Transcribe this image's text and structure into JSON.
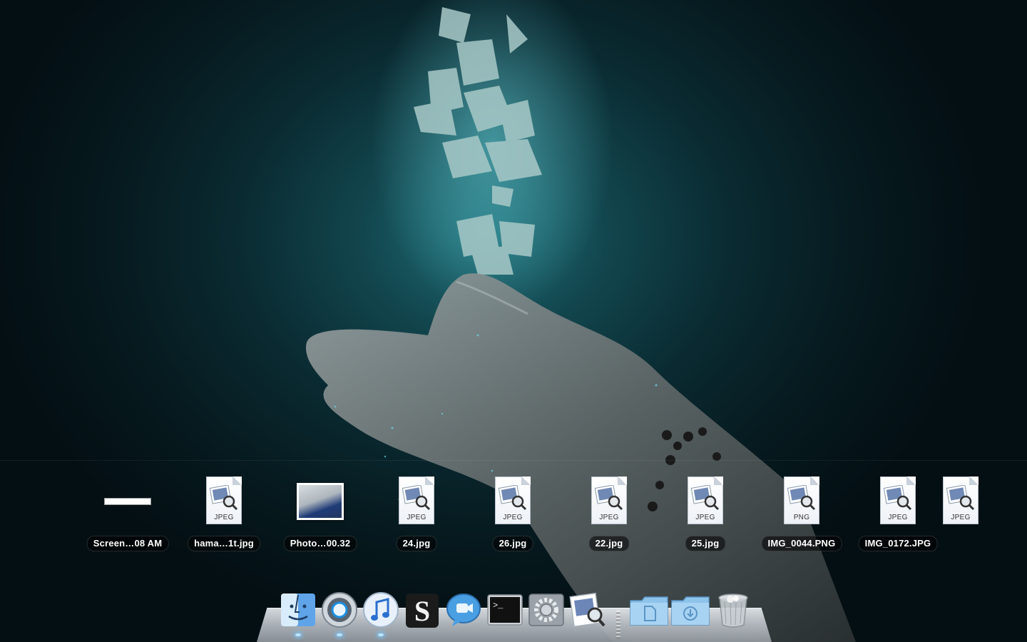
{
  "desktop": {
    "wallpaper_icon": "hand-with-glowing-fragments-wallpaper"
  },
  "stack": {
    "items": [
      {
        "label": "Screen…08 AM",
        "kind": "screenshot",
        "icon": "screenshot-thumbnail-icon"
      },
      {
        "label": "hama…1t.jpg",
        "kind": "doc",
        "type": "JPEG",
        "icon": "jpeg-file-icon"
      },
      {
        "label": "Photo…00.32",
        "kind": "photo",
        "icon": "photo-thumbnail-icon"
      },
      {
        "label": "24.jpg",
        "kind": "doc",
        "type": "JPEG",
        "icon": "jpeg-file-icon"
      },
      {
        "label": "26.jpg",
        "kind": "doc",
        "type": "JPEG",
        "icon": "jpeg-file-icon"
      },
      {
        "label": "22.jpg",
        "kind": "doc",
        "type": "JPEG",
        "icon": "jpeg-file-icon"
      },
      {
        "label": "25.jpg",
        "kind": "doc",
        "type": "JPEG",
        "icon": "jpeg-file-icon"
      },
      {
        "label": "IMG_0044.PNG",
        "kind": "doc",
        "type": "PNG",
        "icon": "png-file-icon"
      },
      {
        "label": "IMG_0172.JPG",
        "kind": "doc",
        "type": "JPEG",
        "icon": "jpeg-file-icon"
      },
      {
        "label": "",
        "kind": "doc",
        "type": "JPEG",
        "icon": "jpeg-file-icon"
      }
    ]
  },
  "dock": {
    "apps": [
      {
        "name": "Finder",
        "icon": "finder-icon",
        "running": true
      },
      {
        "name": "Safari",
        "icon": "compass-icon",
        "running": true
      },
      {
        "name": "iTunes",
        "icon": "music-note-icon",
        "running": true
      },
      {
        "name": "Scrivener",
        "icon": "scrivener-s-icon",
        "running": false
      },
      {
        "name": "iChat",
        "icon": "video-chat-bubble-icon",
        "running": false
      },
      {
        "name": "Terminal",
        "icon": "terminal-icon",
        "running": false
      },
      {
        "name": "System Preferences",
        "icon": "gear-icon",
        "running": false
      },
      {
        "name": "Preview",
        "icon": "preview-icon",
        "running": false
      },
      {
        "name": "Documents",
        "icon": "documents-folder-icon",
        "running": false
      },
      {
        "name": "Downloads",
        "icon": "downloads-folder-icon",
        "running": false
      },
      {
        "name": "Trash",
        "icon": "trash-icon",
        "running": false
      }
    ],
    "terminal_prompt": ">_",
    "scrivener_letter": "S",
    "accent_glow": "#bfe6ff"
  }
}
